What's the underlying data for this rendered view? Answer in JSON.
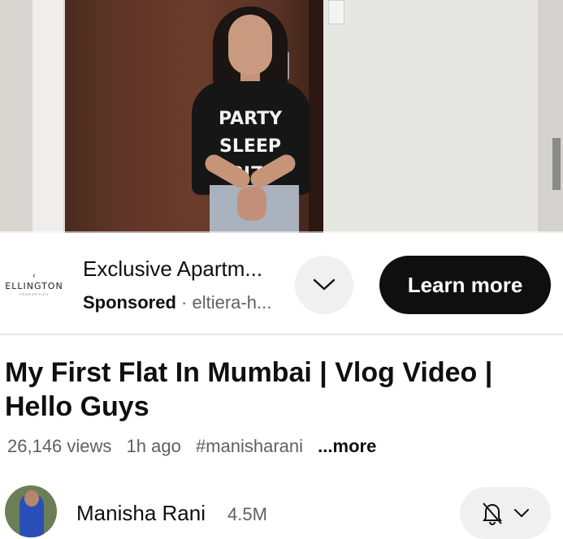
{
  "player": {
    "shirt_lines": [
      "PARTY",
      "SLEEP",
      "IBIZA"
    ]
  },
  "ad": {
    "logo_text": "ELLINGTON",
    "logo_subtext": "PROPERTIES",
    "title": "Exclusive Apartm...",
    "sponsored_label": "Sponsored",
    "separator": "·",
    "domain": "eltiera-h...",
    "cta_label": "Learn more",
    "expand_icon": "chevron-down-icon"
  },
  "video": {
    "title": "My First Flat In Mumbai | Vlog Video | Hello Guys",
    "views": "26,146 views",
    "age": "1h ago",
    "hashtag": "#manisharani",
    "more_label": "...more"
  },
  "channel": {
    "name": "Manisha Rani",
    "subscribers": "4.5M",
    "notification_icon": "bell-off-icon",
    "dropdown_icon": "chevron-down-icon"
  },
  "colors": {
    "cta_background": "#0f0f0f",
    "chip_background": "#f0f0f0",
    "secondary_text": "#606060"
  }
}
